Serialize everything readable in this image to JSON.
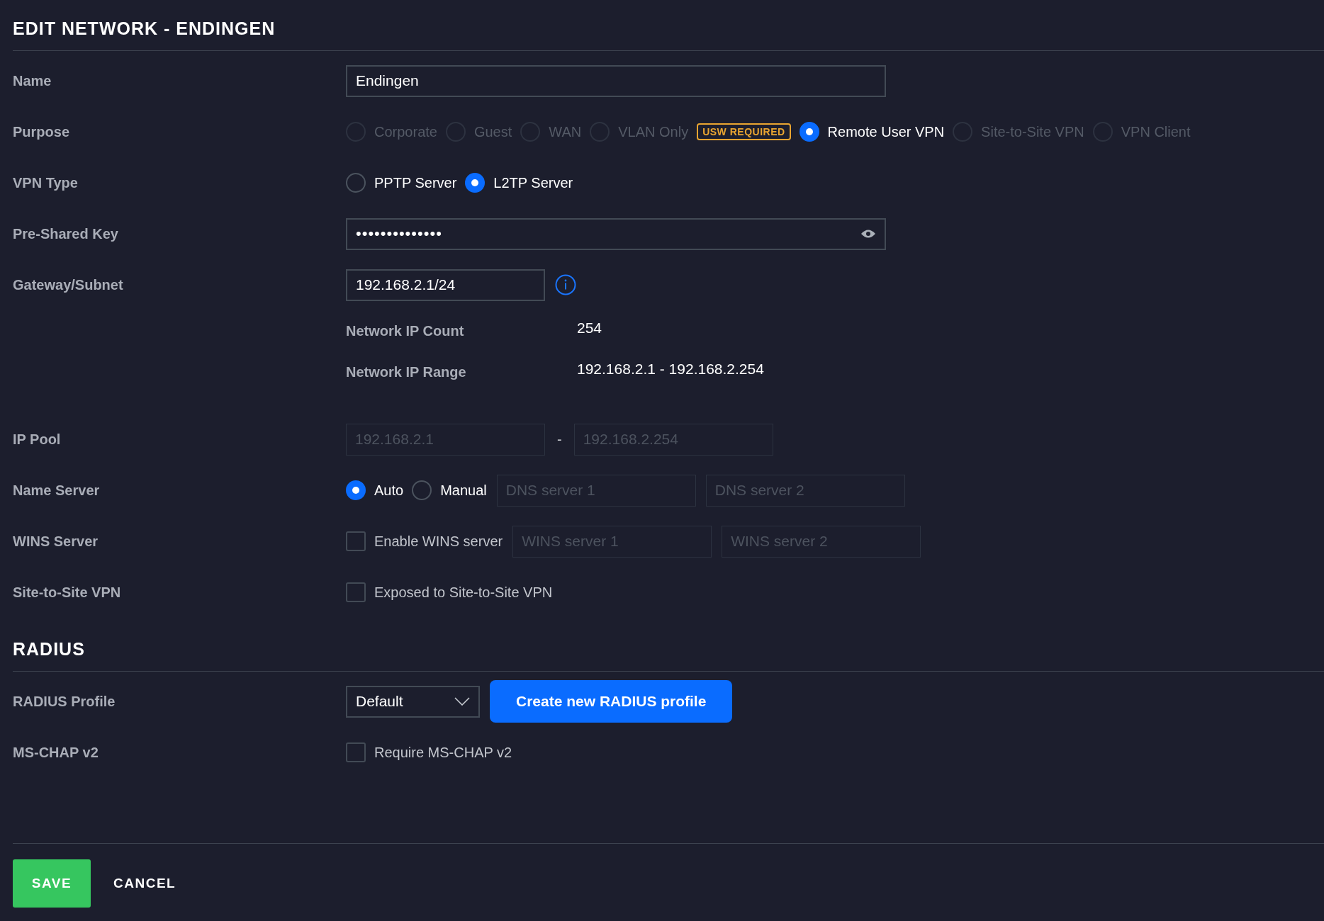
{
  "title": "EDIT NETWORK - ENDINGEN",
  "sections": [
    {
      "rows": [
        {
          "kind": "text",
          "label": "Name",
          "value": "Endingen"
        },
        {
          "kind": "radio",
          "label": "Purpose",
          "options": [
            {
              "label": "Corporate",
              "selected": false,
              "disabled": true
            },
            {
              "label": "Guest",
              "selected": false,
              "disabled": true
            },
            {
              "label": "WAN",
              "selected": false,
              "disabled": true
            },
            {
              "label": "VLAN Only",
              "selected": false,
              "disabled": true,
              "badge": "USW REQUIRED"
            },
            {
              "label": "Remote User VPN",
              "selected": true,
              "disabled": false
            },
            {
              "label": "Site-to-Site VPN",
              "selected": false,
              "disabled": true
            },
            {
              "label": "VPN Client",
              "selected": false,
              "disabled": true
            }
          ]
        },
        {
          "kind": "radio",
          "label": "VPN Type",
          "options": [
            {
              "label": "PPTP Server",
              "selected": false,
              "disabled": false
            },
            {
              "label": "L2TP Server",
              "selected": true,
              "disabled": false
            }
          ]
        },
        {
          "kind": "password",
          "label": "Pre-Shared Key",
          "value": "••••••••••••••"
        },
        {
          "kind": "subnet",
          "label": "Gateway/Subnet",
          "value": "192.168.2.1/24"
        },
        {
          "kind": "stat",
          "label": "Network IP Count",
          "value": "254"
        },
        {
          "kind": "stat",
          "label": "Network IP Range",
          "value": "192.168.2.1 - 192.168.2.254"
        },
        {
          "kind": "range",
          "label": "IP Pool",
          "placeholders": [
            "192.168.2.1",
            "192.168.2.254"
          ],
          "separator": "-"
        },
        {
          "kind": "radio",
          "label": "Name Server",
          "options": [
            {
              "label": "Auto",
              "selected": true,
              "disabled": false
            },
            {
              "label": "Manual",
              "selected": false,
              "disabled": false
            }
          ],
          "placeholders": [
            "DNS server 1",
            "DNS server 2"
          ]
        },
        {
          "kind": "checkbox",
          "label": "WINS Server",
          "option": {
            "label": "Enable WINS server",
            "checked": false
          },
          "placeholders": [
            "WINS server 1",
            "WINS server 2"
          ]
        },
        {
          "kind": "checkbox",
          "label": "Site-to-Site VPN",
          "option": {
            "label": "Exposed to Site-to-Site VPN",
            "checked": false
          }
        }
      ]
    },
    {
      "heading": "RADIUS",
      "rows": [
        {
          "kind": "select",
          "label": "RADIUS Profile",
          "value": "Default",
          "button": "Create new RADIUS profile"
        },
        {
          "kind": "checkbox",
          "label": "MS-CHAP v2",
          "option": {
            "label": "Require MS-CHAP v2",
            "checked": false
          }
        }
      ]
    }
  ],
  "actions": {
    "save": "SAVE",
    "cancel": "CANCEL"
  }
}
